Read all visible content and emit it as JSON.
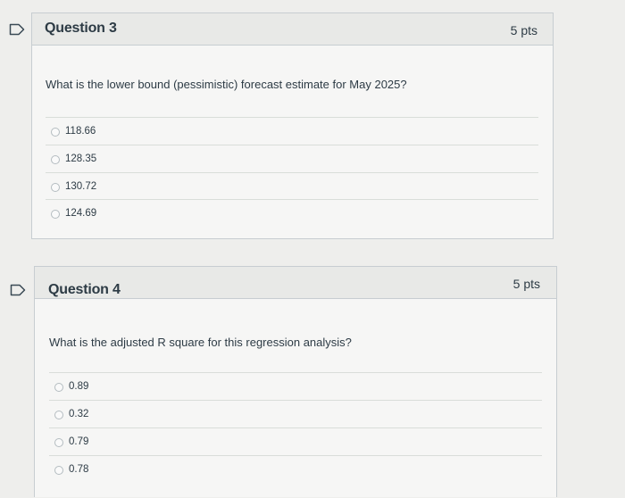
{
  "questions": [
    {
      "title": "Question 3",
      "points": "5 pts",
      "text": "What is the lower bound (pessimistic) forecast estimate for May 2025?",
      "answers": [
        "118.66",
        "128.35",
        "130.72",
        "124.69"
      ]
    },
    {
      "title": "Question 4",
      "points": "5 pts",
      "text": "What is the adjusted R square for this regression analysis?",
      "answers": [
        "0.89",
        "0.32",
        "0.79",
        "0.78"
      ]
    }
  ],
  "colors": {
    "page_background": "#eeeeec",
    "card_background": "#f6f6f5",
    "header_background": "#e8e9e7",
    "border": "#c7cdd1",
    "text": "#2d3b45",
    "flag_stroke": "#2d3b45"
  }
}
